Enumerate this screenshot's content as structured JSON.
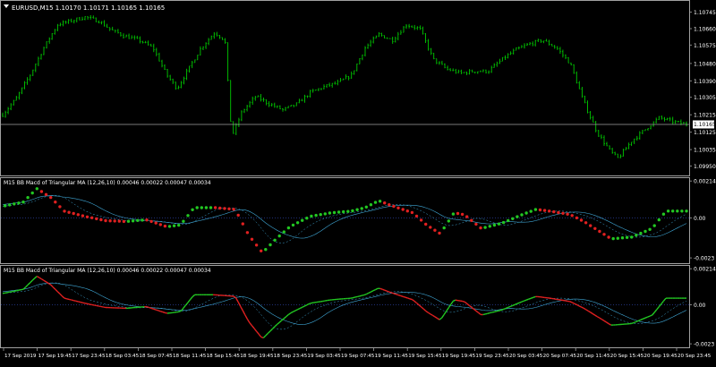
{
  "window": {
    "symbol_header": "EURUSD,M15  1.10170 1.10171 1.10165 1.10165"
  },
  "colors": {
    "background": "#000000",
    "frame": "#a0a0a0",
    "text": "#ffffff",
    "candle": "#00c800",
    "bid_line": "#a0a0a0",
    "rising": "#22c722",
    "falling": "#e02020",
    "signal": "#3fa7d6",
    "level": "#2a3f9a"
  },
  "main_panel": {
    "price_labels": [
      "1.10745",
      "1.10660",
      "1.10575",
      "1.10480",
      "1.10390",
      "1.10305",
      "1.10215",
      "1.10125",
      "1.10035",
      "1.09950"
    ],
    "current_price": "1.10165"
  },
  "indicator1": {
    "label": "M15  BB Macd of Triangular MA (12,26,10) 0.00046 0.00022 0.00047 0.00034",
    "scale_labels": [
      "0.00214",
      "0.00",
      "-0.0023"
    ]
  },
  "indicator2": {
    "label": "M15  BB Macd of Triangular MA (12,26,10) 0.00046 0.00022 0.00047 0.00034",
    "scale_labels": [
      "0.00214",
      "0.00",
      "-0.0023"
    ]
  },
  "time_axis": {
    "labels": [
      "17 Sep 2019",
      "17 Sep 19:45",
      "17 Sep 23:45",
      "18 Sep 03:45",
      "18 Sep 07:45",
      "18 Sep 11:45",
      "18 Sep 15:45",
      "18 Sep 19:45",
      "18 Sep 23:45",
      "19 Sep 03:45",
      "19 Sep 07:45",
      "19 Sep 11:45",
      "19 Sep 15:45",
      "19 Sep 19:45",
      "19 Sep 23:45",
      "20 Sep 03:45",
      "20 Sep 07:45",
      "20 Sep 11:45",
      "20 Sep 15:45",
      "20 Sep 19:45",
      "20 Sep 23:45"
    ]
  },
  "chart_data": {
    "type": "line",
    "close_path": [
      [
        0,
        1.10215
      ],
      [
        2,
        1.103
      ],
      [
        4,
        1.1042
      ],
      [
        6,
        1.1056
      ],
      [
        8,
        1.1068
      ],
      [
        10,
        1.107
      ],
      [
        12,
        1.1072
      ],
      [
        14,
        1.107
      ],
      [
        16,
        1.1065
      ],
      [
        18,
        1.1062
      ],
      [
        20,
        1.106
      ],
      [
        22,
        1.1056
      ],
      [
        24,
        1.1042
      ],
      [
        25.5,
        1.1035
      ],
      [
        27,
        1.1044
      ],
      [
        29,
        1.1056
      ],
      [
        31,
        1.1064
      ],
      [
        32.5,
        1.106
      ],
      [
        33.5,
        1.101
      ],
      [
        35,
        1.1023
      ],
      [
        37,
        1.1031
      ],
      [
        39,
        1.1027
      ],
      [
        41,
        1.1024
      ],
      [
        43,
        1.1027
      ],
      [
        45,
        1.1033
      ],
      [
        47,
        1.1036
      ],
      [
        49,
        1.1038
      ],
      [
        51,
        1.1042
      ],
      [
        53,
        1.1056
      ],
      [
        55,
        1.1063
      ],
      [
        57,
        1.106
      ],
      [
        59,
        1.1068
      ],
      [
        61,
        1.1066
      ],
      [
        63,
        1.105
      ],
      [
        65,
        1.1045
      ],
      [
        67,
        1.1043
      ],
      [
        69,
        1.1044
      ],
      [
        71,
        1.1044
      ],
      [
        73,
        1.105
      ],
      [
        75,
        1.1055
      ],
      [
        77,
        1.1058
      ],
      [
        79,
        1.106
      ],
      [
        81,
        1.1056
      ],
      [
        83,
        1.1048
      ],
      [
        85,
        1.1028
      ],
      [
        87,
        1.1012
      ],
      [
        89,
        1.1002
      ],
      [
        90,
        1.0999
      ],
      [
        92,
        1.1008
      ],
      [
        94,
        1.1014
      ],
      [
        96,
        1.102
      ],
      [
        98,
        1.1018
      ],
      [
        100,
        1.10165
      ]
    ],
    "indicator_path": [
      [
        0,
        0.00068
      ],
      [
        3,
        0.00092
      ],
      [
        5,
        0.0017
      ],
      [
        7,
        0.0012
      ],
      [
        9,
        0.0004
      ],
      [
        12,
        0.0001
      ],
      [
        15,
        -0.00015
      ],
      [
        18,
        -0.0002
      ],
      [
        21,
        -0.0001
      ],
      [
        24,
        -0.0005
      ],
      [
        26,
        -0.0004
      ],
      [
        28,
        0.0006
      ],
      [
        31,
        0.0006
      ],
      [
        34,
        0.0005
      ],
      [
        36,
        -0.001
      ],
      [
        38,
        -0.002
      ],
      [
        40,
        -0.0012
      ],
      [
        42,
        -0.0005
      ],
      [
        45,
        0.0001
      ],
      [
        48,
        0.0003
      ],
      [
        51,
        0.0004
      ],
      [
        53,
        0.0006
      ],
      [
        55,
        0.001
      ],
      [
        57,
        0.0007
      ],
      [
        60,
        0.0003
      ],
      [
        62,
        -0.0004
      ],
      [
        64,
        -0.0009
      ],
      [
        66,
        0.0003
      ],
      [
        67.5,
        0.0002
      ],
      [
        70,
        -0.0006
      ],
      [
        73,
        -0.0003
      ],
      [
        76,
        0.0002
      ],
      [
        78,
        0.0005
      ],
      [
        80,
        0.0004
      ],
      [
        83,
        0.0002
      ],
      [
        85,
        -0.0002
      ],
      [
        87,
        -0.0007
      ],
      [
        89,
        -0.0012
      ],
      [
        92,
        -0.0011
      ],
      [
        95,
        -0.0006
      ],
      [
        97,
        0.0004
      ],
      [
        100,
        0.0004
      ]
    ],
    "price_ylim": [
      1.0992,
      1.1078
    ],
    "indicator_ylim": [
      -0.0024,
      0.00215
    ]
  }
}
